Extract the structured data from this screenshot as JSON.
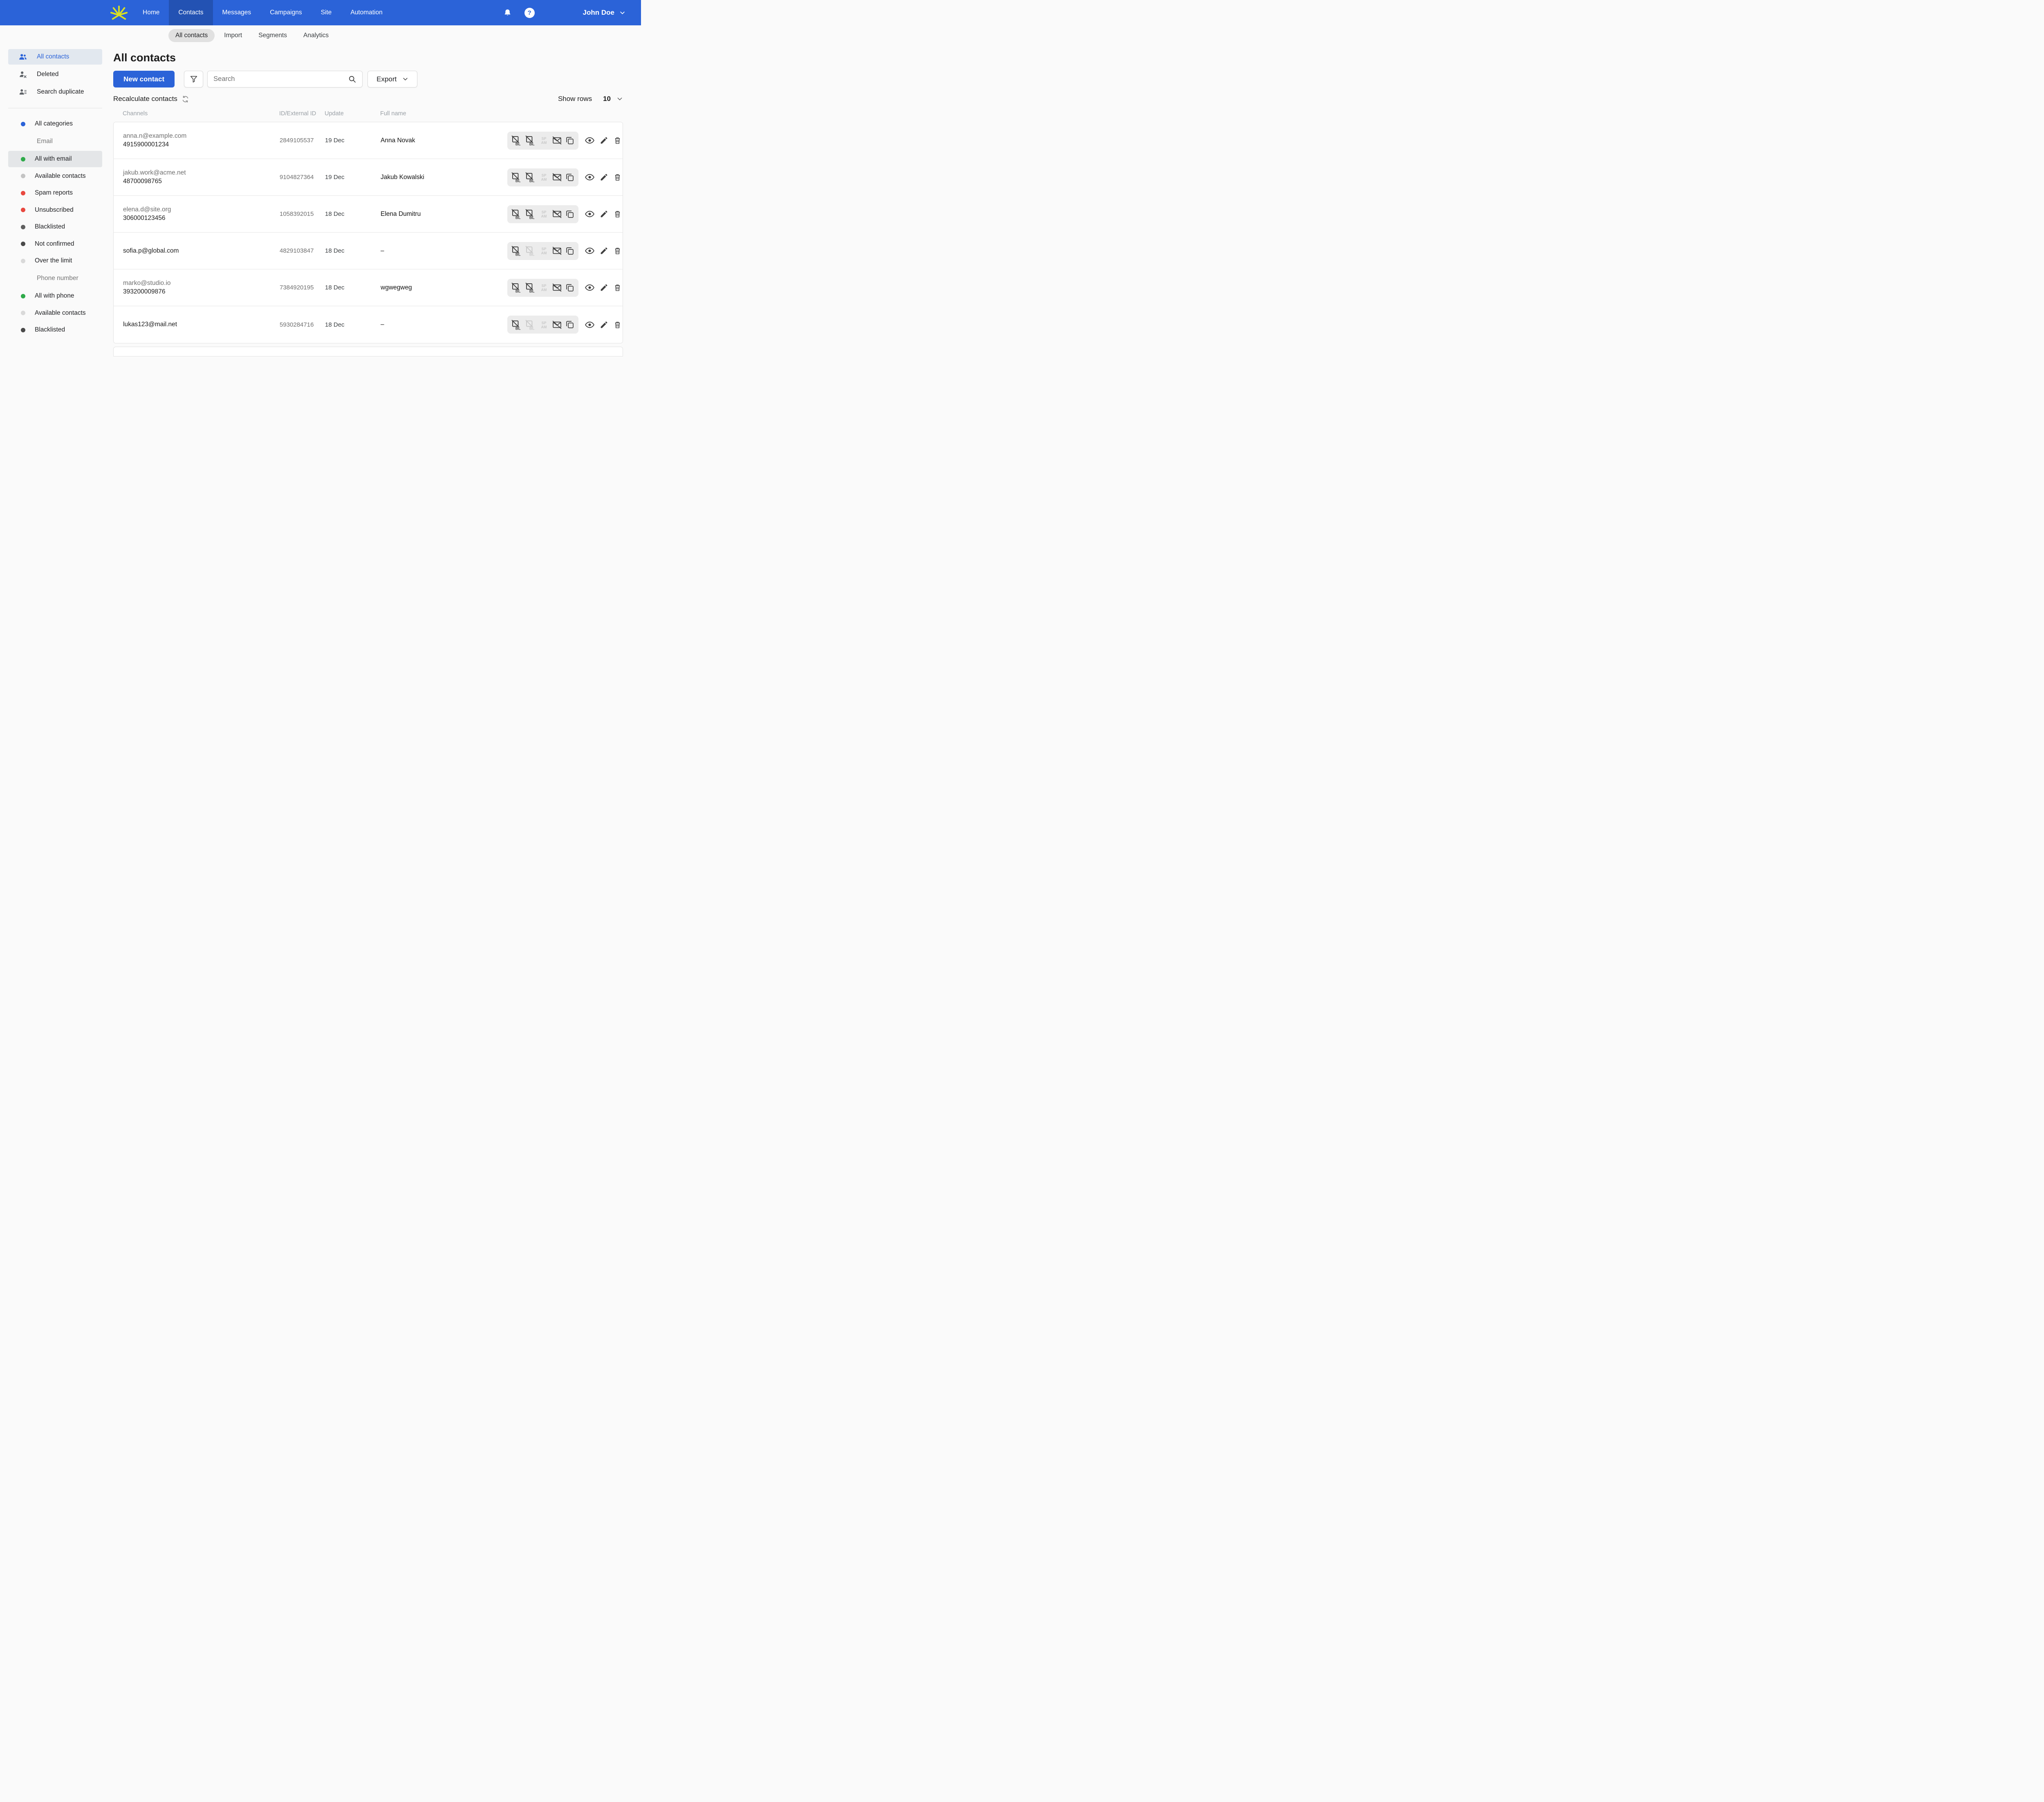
{
  "accent_color": "#2b63d8",
  "brand_color": "#d9e021",
  "nav": {
    "items": [
      {
        "label": "Home",
        "active": false
      },
      {
        "label": "Contacts",
        "active": true
      },
      {
        "label": "Messages",
        "active": false
      },
      {
        "label": "Campaigns",
        "active": false
      },
      {
        "label": "Site",
        "active": false
      },
      {
        "label": "Automation",
        "active": false
      }
    ],
    "help_glyph": "?",
    "user_name": "John Doe"
  },
  "tabs": [
    {
      "label": "All contacts",
      "active": true
    },
    {
      "label": "Import",
      "active": false
    },
    {
      "label": "Segments",
      "active": false
    },
    {
      "label": "Analytics",
      "active": false
    }
  ],
  "sidebar": {
    "top_items": [
      {
        "label": "All contacts",
        "icon": "contacts-people-icon",
        "active": true
      },
      {
        "label": "Deleted",
        "icon": "person-remove-icon",
        "active": false
      },
      {
        "label": "Search duplicate",
        "icon": "people-duplicate-icon",
        "active": false
      }
    ],
    "categories": [
      {
        "label": "All categories",
        "dot": "#2b63d8",
        "active": false
      },
      {
        "label": "Email",
        "section": true
      },
      {
        "label": "All with email",
        "dot": "#2faa4a",
        "active": true
      },
      {
        "label": "Available contacts",
        "dot": "#c4c4c4",
        "active": false
      },
      {
        "label": "Spam reports",
        "dot": "#e8483f",
        "active": false
      },
      {
        "label": "Unsubscribed",
        "dot": "#e8483f",
        "active": false
      },
      {
        "label": "Blacklisted",
        "dot": "#5f5f5f",
        "active": false
      },
      {
        "label": "Not confirmed",
        "dot": "#4a4a4a",
        "active": false
      },
      {
        "label": "Over the limit",
        "dot": "#d9d9d9",
        "active": false
      },
      {
        "label": "Phone number",
        "section": true
      },
      {
        "label": "All with phone",
        "dot": "#2faa4a",
        "active": false
      },
      {
        "label": "Available contacts",
        "dot": "#d9d9d9",
        "active": false
      },
      {
        "label": "Blacklisted",
        "dot": "#4a4a4a",
        "active": false
      }
    ]
  },
  "main": {
    "title": "All contacts",
    "new_contact_label": "New contact",
    "search_placeholder": "Search",
    "export_label": "Export",
    "recalculate_label": "Recalculate contacts",
    "show_rows_label": "Show rows",
    "show_rows_value": "10"
  },
  "table": {
    "headers": [
      "Channels",
      "ID/External ID",
      "Update",
      "Full name"
    ],
    "rows": [
      {
        "email": "anna.n@example.com",
        "phone": "4915900001234",
        "id": "2849105537",
        "update": "19 Dec",
        "name": "Anna Novak",
        "phone_blacklist_active": true
      },
      {
        "email": "jakub.work@acme.net",
        "phone": "48700098765",
        "id": "9104827364",
        "update": "19 Dec",
        "name": "Jakub Kowalski",
        "phone_blacklist_active": true
      },
      {
        "email": "elena.d@site.org",
        "phone": "306000123456",
        "id": "1058392015",
        "update": "18 Dec",
        "name": "Elena Dumitru",
        "phone_blacklist_active": true
      },
      {
        "email": "sofia.p@global.com",
        "phone": "",
        "id": "4829103847",
        "update": "18 Dec",
        "name": "–",
        "phone_blacklist_active": false
      },
      {
        "email": "marko@studio.io",
        "phone": "393200009876",
        "id": "7384920195",
        "update": "18 Dec",
        "name": "wgwegweg",
        "phone_blacklist_active": true
      },
      {
        "email": "lukas123@mail.net",
        "phone": "",
        "id": "5930284716",
        "update": "18 Dec",
        "name": "–",
        "phone_blacklist_active": false
      }
    ]
  }
}
